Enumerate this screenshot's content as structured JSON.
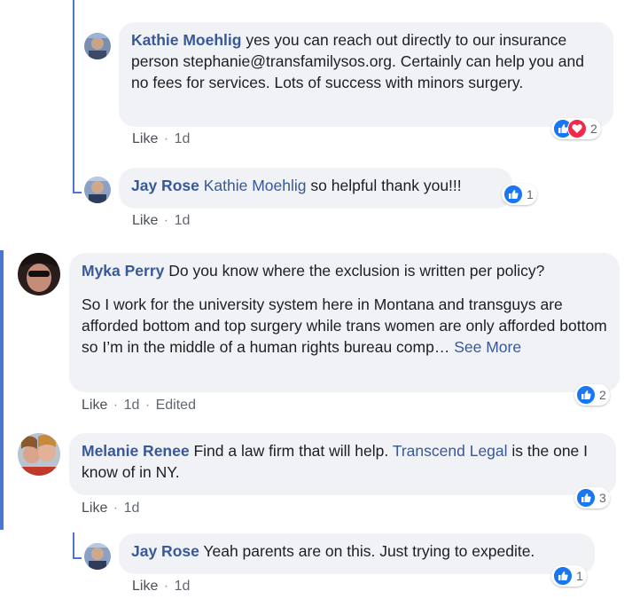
{
  "comments": [
    {
      "author": "Kathie Moehlig",
      "text": "yes you can reach out directly to our insurance person stephanie@transfamilysos.org. Certainly can help you and no fees for services. Lots of success with minors surgery.",
      "like": "Like",
      "time": "1d",
      "reaction_count": "2"
    },
    {
      "author": "Jay Rose",
      "mention": "Kathie Moehlig",
      "text": "so helpful thank you!!!",
      "like": "Like",
      "time": "1d",
      "reaction_count": "1"
    },
    {
      "author": "Myka Perry",
      "text": "Do you know where the exclusion is written per policy?",
      "text2": "So I work for the university system here in Montana and transguys are afforded bottom and top surgery while trans women are only afforded bottom so I’m in the middle of a human rights bureau comp…",
      "see_more": "See More",
      "like": "Like",
      "time": "1d",
      "edited": "Edited",
      "reaction_count": "2"
    },
    {
      "author": "Melanie Renee",
      "text_before": "Find a law firm that will help.",
      "link": "Transcend Legal",
      "text_after": "is the one I know of in NY.",
      "like": "Like",
      "time": "1d",
      "reaction_count": "3"
    },
    {
      "author": "Jay Rose",
      "text": "Yeah parents are on this. Just trying to expedite.",
      "like": "Like",
      "time": "1d",
      "reaction_count": "1"
    }
  ],
  "colors": {
    "accent_line": "#4a76d0",
    "bubble": "#f0f2f5",
    "author": "#385898",
    "like_blue": "#1877f2",
    "love_red": "#f0284a"
  }
}
